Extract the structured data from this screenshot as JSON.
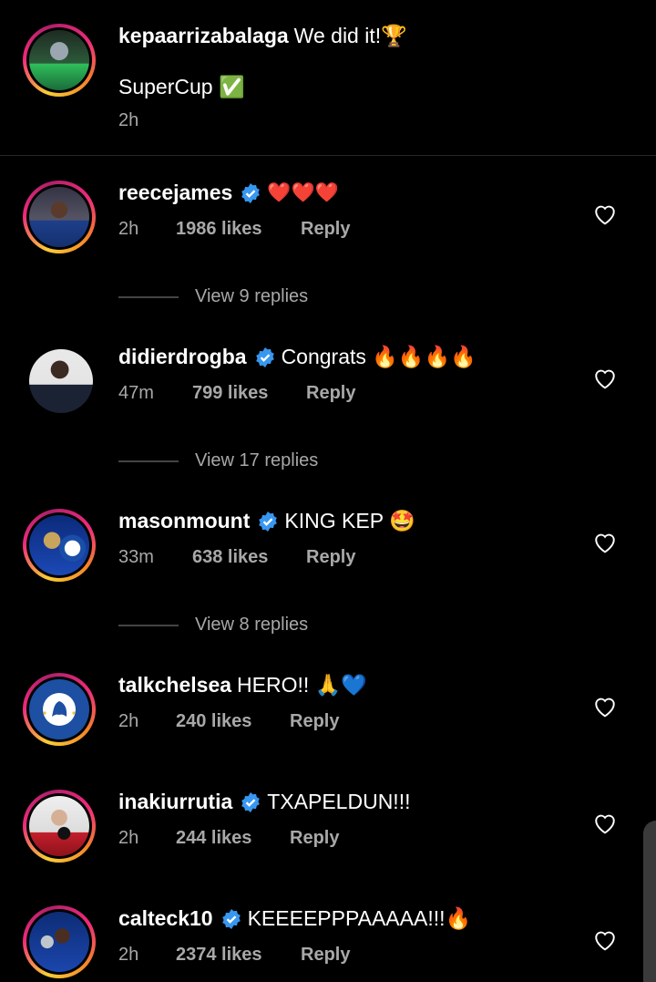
{
  "caption": {
    "username": "kepaarrizabalaga",
    "text": "We did it!🏆",
    "text2": "SuperCup ✅",
    "time": "2h"
  },
  "comments": [
    {
      "username": "reecejames",
      "verified": true,
      "text": "❤️❤️❤️",
      "time": "2h",
      "likes": "1986 likes",
      "reply": "Reply",
      "view_replies": "View 9 replies"
    },
    {
      "username": "didierdrogba",
      "verified": true,
      "text": "Congrats 🔥🔥🔥🔥",
      "time": "47m",
      "likes": "799 likes",
      "reply": "Reply",
      "view_replies": "View 17 replies"
    },
    {
      "username": "masonmount",
      "verified": true,
      "text": "KING KEP 🤩",
      "time": "33m",
      "likes": "638 likes",
      "reply": "Reply",
      "view_replies": "View 8 replies"
    },
    {
      "username": "talkchelsea",
      "verified": false,
      "text": "HERO!! 🙏💙",
      "time": "2h",
      "likes": "240 likes",
      "reply": "Reply"
    },
    {
      "username": "inakiurrutia",
      "verified": true,
      "text": "TXAPELDUN!!!",
      "time": "2h",
      "likes": "244 likes",
      "reply": "Reply"
    },
    {
      "username": "calteck10",
      "verified": true,
      "text": "KEEEEPPPAAAAA!!!🔥",
      "time": "2h",
      "likes": "2374 likes",
      "reply": "Reply"
    }
  ],
  "icons": {
    "heart": "heart-outline-icon",
    "verified": "verified-badge-icon"
  },
  "colors": {
    "background": "#000000",
    "secondary_text": "#a8a8a8",
    "verified": "#3897f0"
  }
}
